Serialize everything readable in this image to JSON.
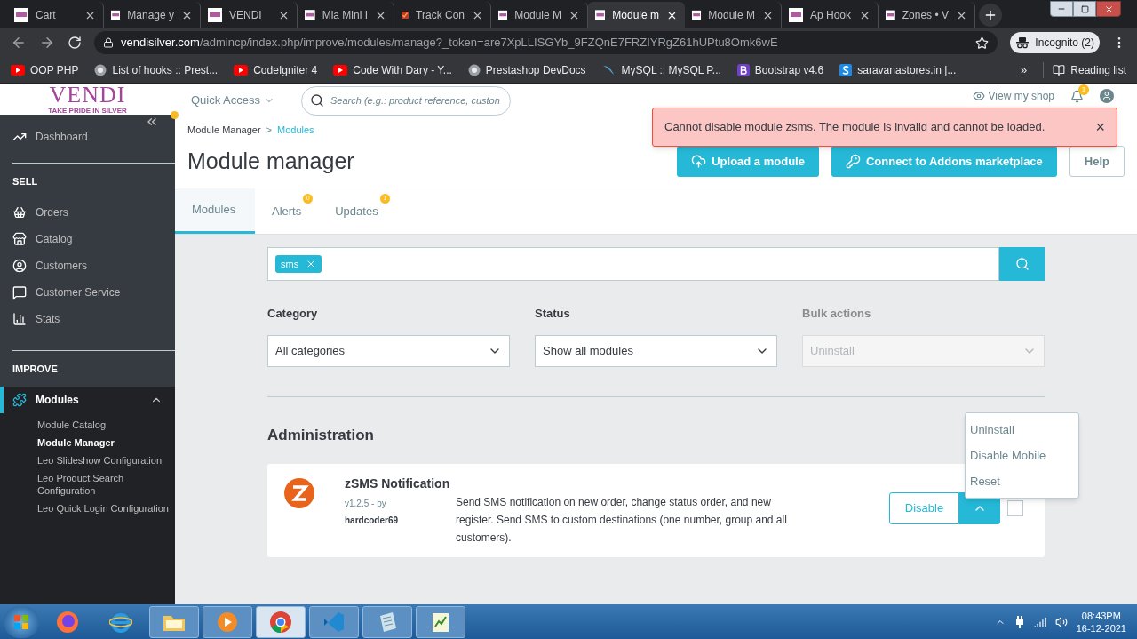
{
  "browser": {
    "tabs": [
      {
        "title": "Cart",
        "selected": false
      },
      {
        "title": "Manage y",
        "selected": false
      },
      {
        "title": "VENDI",
        "selected": false
      },
      {
        "title": "Mia Mini I",
        "selected": false
      },
      {
        "title": "Track Con",
        "selected": false
      },
      {
        "title": "Module M",
        "selected": false
      },
      {
        "title": "Module m",
        "selected": true
      },
      {
        "title": "Module M",
        "selected": false
      },
      {
        "title": "Ap Hook",
        "selected": false
      },
      {
        "title": "Zones • V",
        "selected": false
      }
    ],
    "address_host": "vendisilver.com",
    "address_path": "/admincp/index.php/improve/modules/manage?_token=are7XpLLISGYb_9FZQnE7FRZIYRgZ61hUPtu8Omk6wE",
    "profile": "Incognito (2)",
    "bookmarks": [
      "OOP PHP",
      "List of hooks :: Prest...",
      "CodeIgniter 4",
      "Code With Dary - Y...",
      "Prestashop DevDocs",
      "MySQL :: MySQL P...",
      "Bootstrap v4.6",
      "saravanastores.in |..."
    ],
    "more_bookmarks": "»",
    "reading_list": "Reading list"
  },
  "header": {
    "logo": "VENDI",
    "tagline": "TAKE PRIDE IN SILVER",
    "quick_access": "Quick Access",
    "search_placeholder": "Search (e.g.: product reference, custon",
    "view_shop": "View my shop",
    "notification_count": "1"
  },
  "alert": {
    "message": "Cannot disable module zsms. The module is invalid and cannot be loaded.",
    "close": "×"
  },
  "sidebar": {
    "top": [
      {
        "label": "Dashboard"
      }
    ],
    "sections": [
      {
        "title": "SELL",
        "items": [
          {
            "label": "Orders",
            "selected": false
          },
          {
            "label": "Catalog",
            "selected": false
          },
          {
            "label": "Customers",
            "selected": false
          },
          {
            "label": "Customer Service",
            "selected": false
          },
          {
            "label": "Stats",
            "selected": false
          }
        ]
      },
      {
        "title": "IMPROVE",
        "items": [
          {
            "label": "Modules",
            "selected": true,
            "expanded": true,
            "children": [
              {
                "label": "Module Catalog",
                "selected": false
              },
              {
                "label": "Module Manager",
                "selected": true
              },
              {
                "label": "Leo Slideshow Configuration",
                "selected": false
              },
              {
                "label": "Leo Product Search Configuration",
                "selected": false
              },
              {
                "label": "Leo Quick Login Configuration",
                "selected": false
              }
            ]
          }
        ]
      }
    ]
  },
  "breadcrumb": [
    {
      "label": "Module Manager",
      "current": false
    },
    {
      "label": "Modules",
      "current": true
    }
  ],
  "breadcrumb_separator": ">",
  "title": "Module manager",
  "actions": [
    {
      "label": "Upload a module",
      "kind": "primary"
    },
    {
      "label": "Connect to Addons marketplace",
      "kind": "primary"
    },
    {
      "label": "Help",
      "kind": "outline"
    }
  ],
  "tabs": [
    {
      "label": "Modules",
      "selected": true
    },
    {
      "label": "Alerts",
      "selected": false,
      "badge": "0"
    },
    {
      "label": "Updates",
      "selected": false,
      "badge": "1"
    }
  ],
  "search": {
    "chips": [
      {
        "label": "sms"
      }
    ]
  },
  "filters": [
    {
      "label": "Category",
      "value": "All categories",
      "disabled": false
    },
    {
      "label": "Status",
      "value": "Show all modules",
      "disabled": false
    },
    {
      "label": "Bulk actions",
      "value": "Uninstall",
      "disabled": true
    }
  ],
  "section_title": "Administration",
  "modules": [
    {
      "name": "zSMS Notification",
      "version": "v1.2.5 - by",
      "author": "hardcoder69",
      "description": "Send SMS notification on new order, change status order, and new register. Send SMS to custom destinations (one number, group and all customers).",
      "action": "Disable",
      "menu_expanded": true,
      "menu": [
        "Uninstall",
        "Disable Mobile",
        "Reset"
      ],
      "checked": false
    }
  ],
  "taskbar": {
    "time": "08:43PM",
    "date": "16-12-2021"
  }
}
